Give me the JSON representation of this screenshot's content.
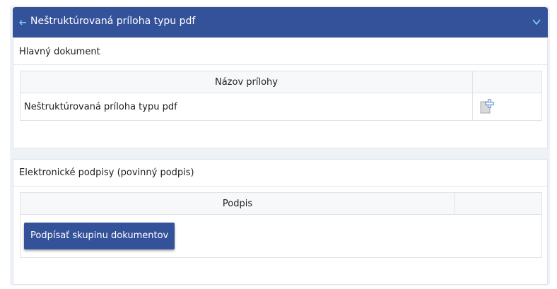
{
  "header": {
    "title": "Neštruktúrovaná príloha typu pdf",
    "back_icon": "left-arrow-icon",
    "toggle_icon": "chevron-down-icon"
  },
  "main_document": {
    "section_label": "Hlavný dokument",
    "table": {
      "column_header": "Názov prílohy",
      "rows": [
        {
          "name": "Neštruktúrovaná príloha typu pdf",
          "action_icon": "add-document-icon"
        }
      ]
    }
  },
  "signatures": {
    "section_label": "Elektronické podpisy (povinný podpis)",
    "table": {
      "column_header": "Podpis"
    },
    "sign_button_label": "Podpísať skupinu dokumentov"
  },
  "colors": {
    "header_bg": "#34529a",
    "button_bg": "#34529a",
    "outer_bg": "#eef1f6"
  }
}
